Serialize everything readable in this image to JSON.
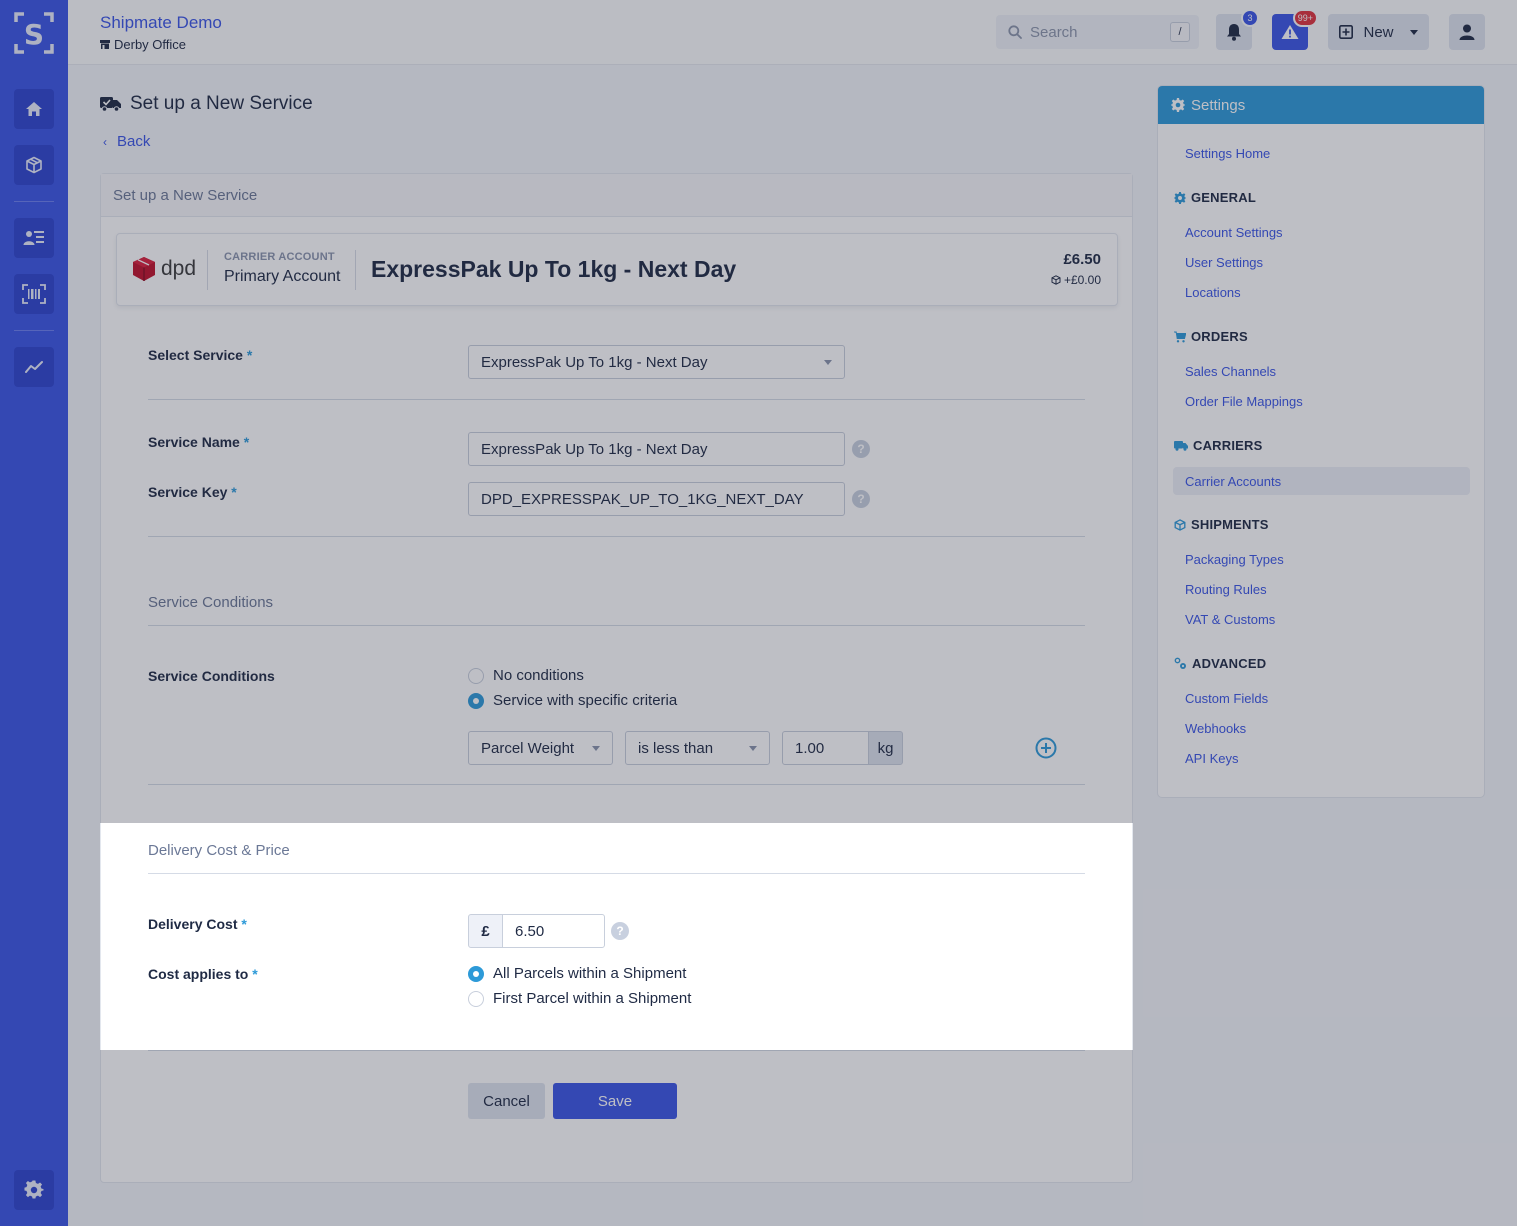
{
  "app": {
    "org_name": "Shipmate Demo",
    "location": "Derby Office",
    "location_icon": "store-icon"
  },
  "rail": {
    "logo": "S",
    "items": [
      {
        "name": "home",
        "icon": "home-icon"
      },
      {
        "name": "shipments",
        "icon": "box-icon"
      },
      {
        "name": "contacts",
        "icon": "address-card-icon"
      },
      {
        "name": "scan",
        "icon": "barcode-scan-icon"
      },
      {
        "name": "reports",
        "icon": "chart-line-icon"
      }
    ],
    "footer_icon": "gear-icon"
  },
  "topbar": {
    "search_placeholder": "Search",
    "search_shortcut": "/",
    "notifications_count": "3",
    "alerts_count": "99+",
    "new_label": "New"
  },
  "page": {
    "title": "Set up a New Service",
    "back_label": "Back",
    "card_title": "Set up a New Service"
  },
  "summary": {
    "carrier_logo_text": "dpd",
    "carrier_account_label": "CARRIER ACCOUNT",
    "carrier_account_name": "Primary Account",
    "service_name": "ExpressPak Up To 1kg - Next Day",
    "price": "£6.50",
    "extra_price": "+£0.00"
  },
  "form": {
    "select_service_label": "Select Service",
    "select_service_value": "ExpressPak Up To 1kg - Next Day",
    "service_name_label": "Service Name",
    "service_name_value": "ExpressPak Up To 1kg - Next Day",
    "service_key_label": "Service Key",
    "service_key_value": "DPD_EXPRESSPAK_UP_TO_1KG_NEXT_DAY",
    "required_mark": "*",
    "help_mark": "?",
    "conditions_section_title": "Service Conditions",
    "conditions_label": "Service Conditions",
    "conditions_options": [
      {
        "label": "No conditions",
        "selected": false
      },
      {
        "label": "Service with specific criteria",
        "selected": true
      }
    ],
    "condition_rule": {
      "field": "Parcel Weight",
      "operator": "is less than",
      "value": "1.00",
      "unit": "kg"
    },
    "cost_section_title": "Delivery Cost & Price",
    "delivery_cost_label": "Delivery Cost",
    "currency_symbol": "£",
    "delivery_cost_value": "6.50",
    "cost_applies_label": "Cost applies to",
    "cost_applies_options": [
      {
        "label": "All Parcels within a Shipment",
        "selected": true
      },
      {
        "label": "First Parcel within a Shipment",
        "selected": false
      }
    ],
    "cancel_label": "Cancel",
    "save_label": "Save"
  },
  "settings": {
    "title": "Settings",
    "home_link": "Settings Home",
    "groups": [
      {
        "title": "GENERAL",
        "icon": "gear-icon",
        "items": [
          "Account Settings",
          "User Settings",
          "Locations"
        ]
      },
      {
        "title": "ORDERS",
        "icon": "cart-icon",
        "items": [
          "Sales Channels",
          "Order File Mappings"
        ]
      },
      {
        "title": "CARRIERS",
        "icon": "truck-icon",
        "items": [
          "Carrier Accounts"
        ]
      },
      {
        "title": "SHIPMENTS",
        "icon": "box-icon",
        "items": [
          "Packaging Types",
          "Routing Rules",
          "VAT & Customs"
        ]
      },
      {
        "title": "ADVANCED",
        "icon": "gears-icon",
        "items": [
          "Custom Fields",
          "Webhooks",
          "API Keys"
        ]
      }
    ],
    "active_item": "Carrier Accounts"
  },
  "colors": {
    "brand": "#3a55e6",
    "accent": "#2d9ad8",
    "danger": "#e0323c"
  }
}
